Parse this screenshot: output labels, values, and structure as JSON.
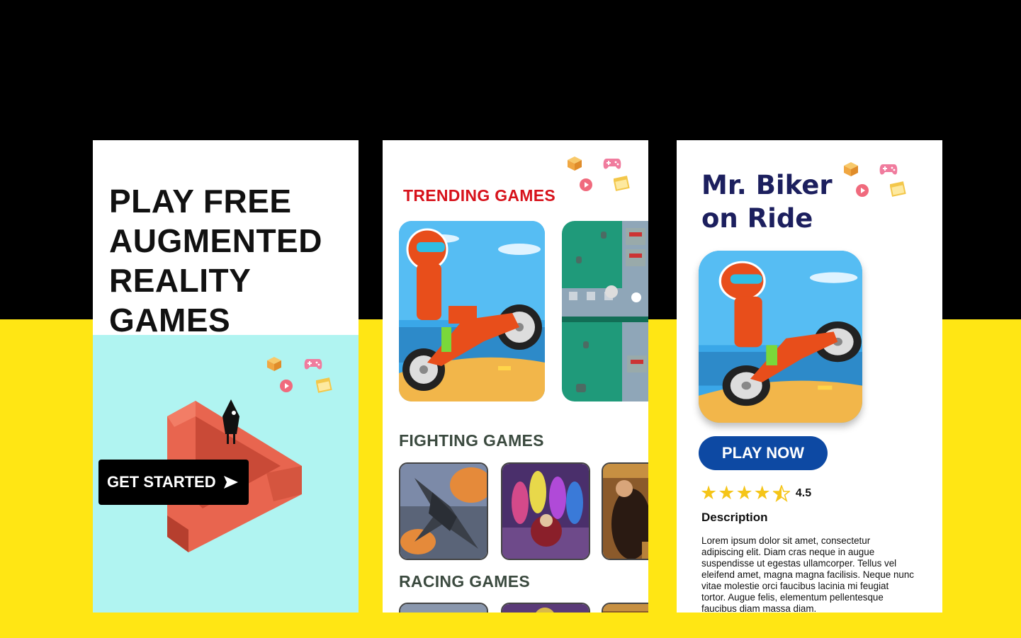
{
  "screen1": {
    "hero_title_lines": [
      "PLAY FREE",
      "AUGMENTED",
      "REALITY",
      "GAMES"
    ],
    "cta_label": "GET STARTED",
    "cta_icon": "send-arrow-icon"
  },
  "screen2": {
    "trending_title": "TRENDING GAMES",
    "fighting_title": "FIGHTING GAMES",
    "racing_title": "RACING GAMES"
  },
  "screen3": {
    "title_lines": [
      "Mr. Biker",
      "on Ride"
    ],
    "play_label": "PLAY NOW",
    "rating_value": "4.5",
    "rating_stars": 4.5,
    "description_heading": "Description",
    "description_text": "Lorem ipsum dolor sit amet, consectetur adipiscing elit. Diam cras neque in augue suspendisse ut egestas ullamcorper. Tellus vel eleifend amet, magna magna facilisis. Neque nunc vitae molestie orci faucibus lacinia mi feugiat tortor. Augue felis, elementum pellentesque faucibus diam massa diam."
  },
  "colors": {
    "background_top": "#000000",
    "background_bottom": "#ffe614",
    "hero_area": "#b0f4f1",
    "trending_red": "#d7121b",
    "section_green": "#3b4a3f",
    "title_navy": "#1c1f5e",
    "play_blue": "#0d49a3",
    "star_yellow": "#f5c518"
  },
  "icons": [
    "cube-icon",
    "gamepad-icon",
    "play-circle-icon",
    "window-icon"
  ]
}
